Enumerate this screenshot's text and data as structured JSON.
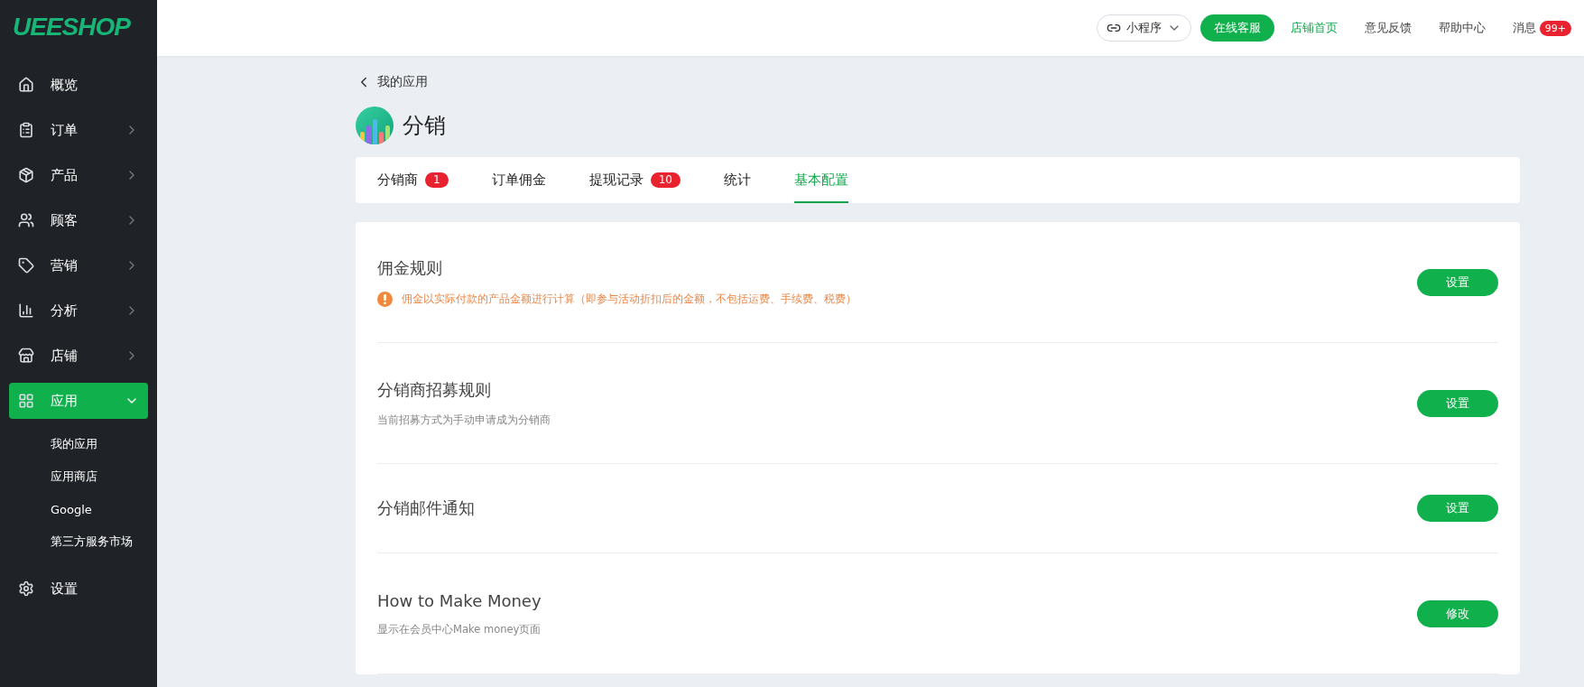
{
  "logo": "UEESHOP",
  "topbar": {
    "mini_program": "小程序",
    "service_button": "在线客服",
    "links": [
      {
        "label": "店铺首页",
        "selected": true
      },
      {
        "label": "意见反馈",
        "selected": false
      },
      {
        "label": "帮助中心",
        "selected": false
      }
    ],
    "messages": {
      "label": "消息",
      "badge": "99+"
    }
  },
  "sidebar": {
    "items": [
      {
        "kind": "link",
        "label": "概览",
        "selected": false
      },
      {
        "kind": "group",
        "label": "订单",
        "expanded": false,
        "selected": false
      },
      {
        "kind": "group",
        "label": "产品",
        "expanded": false,
        "selected": false
      },
      {
        "kind": "group",
        "label": "顾客",
        "expanded": false,
        "selected": false
      },
      {
        "kind": "group",
        "label": "营销",
        "expanded": false,
        "selected": false
      },
      {
        "kind": "group",
        "label": "分析",
        "expanded": false,
        "selected": false
      },
      {
        "kind": "group",
        "label": "店铺",
        "expanded": false,
        "selected": false
      },
      {
        "kind": "group",
        "label": "应用",
        "expanded": true,
        "selected": true,
        "children": [
          {
            "label": "我的应用"
          },
          {
            "label": "应用商店"
          },
          {
            "label": "Google"
          },
          {
            "label": "第三方服务市场"
          }
        ]
      },
      {
        "kind": "link",
        "label": "设置",
        "selected": false
      }
    ]
  },
  "breadcrumb": "我的应用",
  "app_title": "分销",
  "tabs": [
    {
      "label": "分销商",
      "badge": "1",
      "selected": false
    },
    {
      "label": "订单佣金",
      "selected": false
    },
    {
      "label": "提现记录",
      "badge": "10",
      "selected": false
    },
    {
      "label": "统计",
      "selected": false
    },
    {
      "label": "基本配置",
      "selected": true
    }
  ],
  "settings": [
    {
      "title": "佣金规则",
      "note": {
        "kind": "warning",
        "text": "佣金以实际付款的产品金额进行计算（即参与活动折扣后的金额，不包括运费、手续费、税费）"
      },
      "button": "设置"
    },
    {
      "title": "分销商招募规则",
      "note": {
        "kind": "plain",
        "text": "当前招募方式为手动申请成为分销商"
      },
      "button": "设置"
    },
    {
      "title": "分销邮件通知",
      "button": "设置"
    },
    {
      "title": "How to Make Money",
      "note": {
        "kind": "plain",
        "text": "显示在会员中心Make money页面"
      },
      "button": "修改"
    }
  ]
}
